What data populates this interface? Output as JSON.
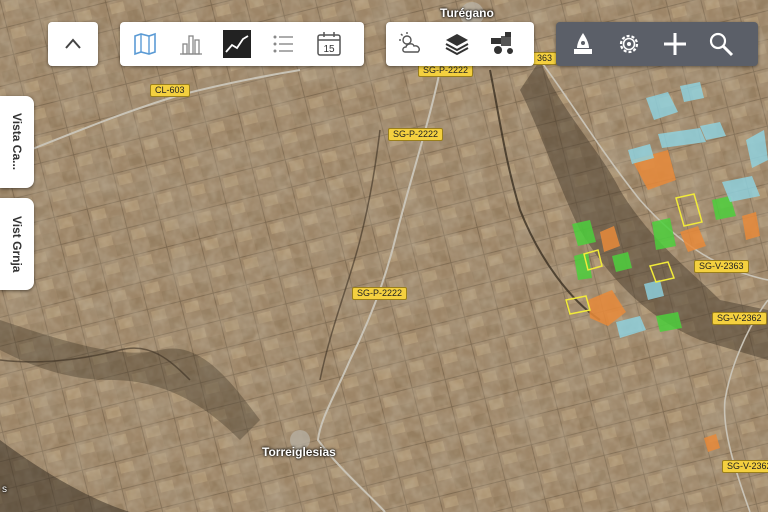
{
  "map": {
    "roads": [
      {
        "label": "CL-603"
      },
      {
        "label": "SG-P-2222"
      },
      {
        "label": "SG-P-2222"
      },
      {
        "label": "SG-V-2363"
      },
      {
        "label": "SG-V-2362"
      },
      {
        "label": "SG-V-2362"
      },
      {
        "label": "SG-P-2222"
      },
      {
        "label": "363"
      }
    ],
    "towns": [
      {
        "label": "Torreiglesias"
      },
      {
        "label": "Turégano"
      }
    ],
    "attribution": "s"
  },
  "side_tabs": {
    "satellite_view": "Vista Ca...",
    "farm_view": "Vist Grnja"
  },
  "toolbar": {
    "collapse_icon": "chevron-up-icon",
    "views": [
      "map-icon",
      "bar-chart-icon",
      "line-chart-icon",
      "list-icon",
      "calendar-icon"
    ],
    "calendar_day": "15",
    "active_view": "line-chart-icon",
    "layers": [
      "weather-icon",
      "layers-icon",
      "harvester-icon"
    ],
    "tools": [
      "location-icon",
      "gear-icon",
      "plus-icon",
      "search-icon"
    ]
  },
  "colors": {
    "field_green": "#4ccf3c",
    "field_orange": "#e88a3a",
    "field_cyan": "#8fd4e4",
    "field_yellow": "#d4d43a",
    "road_label": "#f4d03f",
    "toolbar_dark": "#5b5f68"
  }
}
